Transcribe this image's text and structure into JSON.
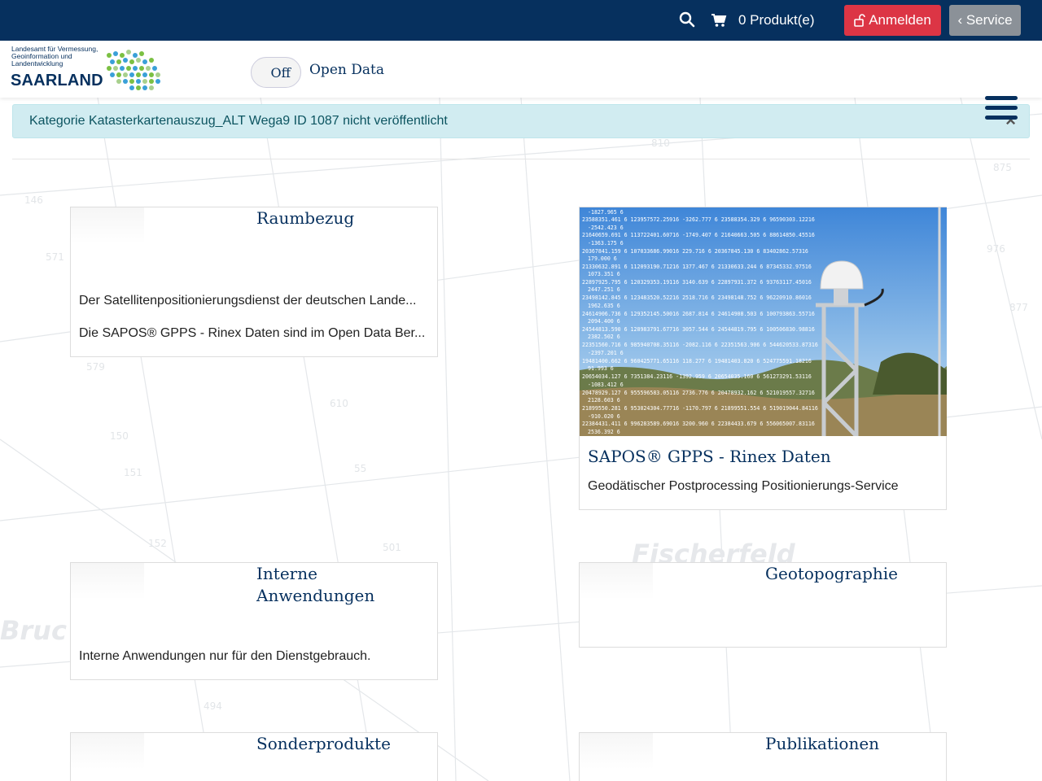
{
  "topbar": {
    "cart_label": "0 Produkt(e)",
    "login_label": "Anmelden",
    "service_label": "‹ Service"
  },
  "header": {
    "logo_tagline": "Landesamt für Vermessung, Geoinformation und Landentwicklung",
    "logo_brand": "SAARLAND",
    "toggle_value": "Off",
    "opendata_label": "Open Data"
  },
  "alert": {
    "message": "Kategorie Katasterkartenauszug_ALT Wega9 ID 1087 nicht veröffentlicht",
    "close": "×"
  },
  "cards": [
    {
      "title": "Raumbezug",
      "lines": [
        "Der Satellitenpositionierungsdienst der deutschen Lande...",
        "Die SAPOS® GPPS - Rinex Daten sind im Open Data Ber..."
      ]
    },
    {
      "title": "SAPOS® GPPS - Rinex Daten",
      "lines": [
        "Geodätischer Postprocessing Positionierungs-Service"
      ]
    },
    {
      "title_line1": "Interne",
      "title_line2": "Anwendungen",
      "lines": [
        "Interne Anwendungen nur für den Dienstgebrauch."
      ]
    },
    {
      "title": "Geotopographie"
    },
    {
      "title": "Sonderprodukte"
    },
    {
      "title": "Publikationen"
    }
  ],
  "colors": {
    "navy": "#06305e",
    "login_red": "#dc3545",
    "service_gray": "#8b9198",
    "alert_bg": "#d1ecf1"
  },
  "icons": [
    "search-icon",
    "cart-icon",
    "lock-icon",
    "close-icon",
    "hamburger-icon"
  ]
}
